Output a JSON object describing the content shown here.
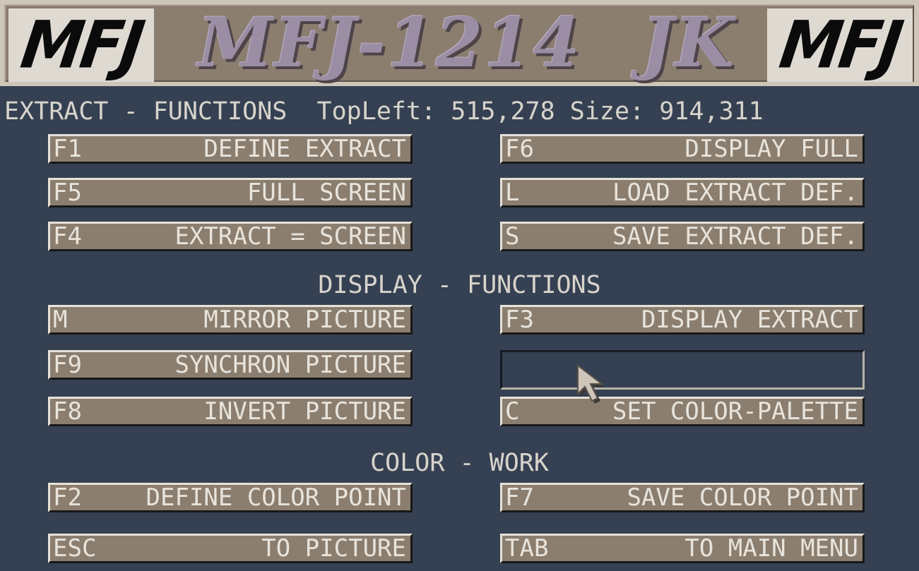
{
  "header": {
    "logo_left": "MFJ",
    "title": "MFJ-1214",
    "title_suffix": "JK",
    "logo_right": "MFJ"
  },
  "status": {
    "section": "EXTRACT - FUNCTIONS",
    "topleft_label": "TopLeft:",
    "topleft_value": "515,278",
    "size_label": "Size:",
    "size_value": "914,311"
  },
  "extract_functions": {
    "left": [
      {
        "key": "F1",
        "label": "DEFINE EXTRACT"
      },
      {
        "key": "F5",
        "label": "FULL SCREEN"
      },
      {
        "key": "F4",
        "label": "EXTRACT = SCREEN"
      }
    ],
    "right": [
      {
        "key": "F6",
        "label": "DISPLAY FULL"
      },
      {
        "key": "L",
        "label": "LOAD EXTRACT DEF."
      },
      {
        "key": "S",
        "label": "SAVE EXTRACT DEF."
      }
    ]
  },
  "display_functions": {
    "title": "DISPLAY - FUNCTIONS",
    "left": [
      {
        "key": "M",
        "label": "MIRROR PICTURE"
      },
      {
        "key": "F9",
        "label": "SYNCHRON PICTURE"
      },
      {
        "key": "F8",
        "label": "INVERT PICTURE"
      }
    ],
    "right": [
      {
        "key": "F3",
        "label": "DISPLAY EXTRACT"
      },
      {
        "key": "",
        "label": ""
      },
      {
        "key": "C",
        "label": "SET COLOR-PALETTE"
      }
    ]
  },
  "color_work": {
    "title": "COLOR - WORK",
    "left": [
      {
        "key": "F2",
        "label": "DEFINE COLOR POINT"
      },
      {
        "key": "ESC",
        "label": "TO PICTURE"
      }
    ],
    "right": [
      {
        "key": "F7",
        "label": "SAVE COLOR POINT"
      },
      {
        "key": "TAB",
        "label": "TO MAIN MENU"
      }
    ]
  },
  "colors": {
    "background": "#354152",
    "button_face": "#8b7e6f",
    "text": "#d8d4cc"
  }
}
